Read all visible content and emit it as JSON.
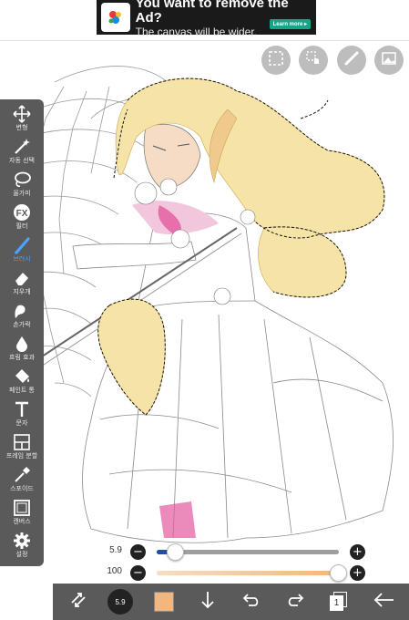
{
  "ad": {
    "title": "You want to remove the Ad?",
    "subtitle": "The canvas will be wider.",
    "cta": "Learn more ▸",
    "logo_icon": "ibispaint-logo-icon"
  },
  "top_tools": [
    {
      "name": "selection-icon"
    },
    {
      "name": "hand-gesture-icon"
    },
    {
      "name": "ruler-icon"
    },
    {
      "name": "image-icon"
    }
  ],
  "toolbar": {
    "items": [
      {
        "label": "변형",
        "icon": "move-icon"
      },
      {
        "label": "자동 선택",
        "icon": "magic-wand-icon"
      },
      {
        "label": "올가미",
        "icon": "lasso-icon"
      },
      {
        "label": "필터",
        "icon": "fx-icon"
      },
      {
        "label": "브러시",
        "icon": "brush-icon",
        "active": true
      },
      {
        "label": "지우개",
        "icon": "eraser-icon"
      },
      {
        "label": "손가락",
        "icon": "smudge-icon"
      },
      {
        "label": "흐림 효과",
        "icon": "blur-icon"
      },
      {
        "label": "페인트 통",
        "icon": "paint-bucket-icon"
      },
      {
        "label": "문자",
        "icon": "text-icon"
      },
      {
        "label": "프레임 분할",
        "icon": "frame-divider-icon"
      },
      {
        "label": "스포이드",
        "icon": "eyedropper-icon"
      },
      {
        "label": "캔버스",
        "icon": "canvas-icon"
      },
      {
        "label": "설정",
        "icon": "gear-icon"
      }
    ],
    "active_color": "#4aa3ff"
  },
  "sliders": {
    "size": {
      "value": "5.9",
      "fraction": 0.1
    },
    "opacity": {
      "value": "100",
      "fraction": 1.0
    }
  },
  "bottom_bar": {
    "brush_size_label": "5.9",
    "layer_count": "1",
    "current_color": "#f2b77e"
  },
  "colors": {
    "toolbar_bg": "#5a5a5a",
    "hair": "#f6e3a8",
    "skin_shadow": "#e35aa0"
  }
}
